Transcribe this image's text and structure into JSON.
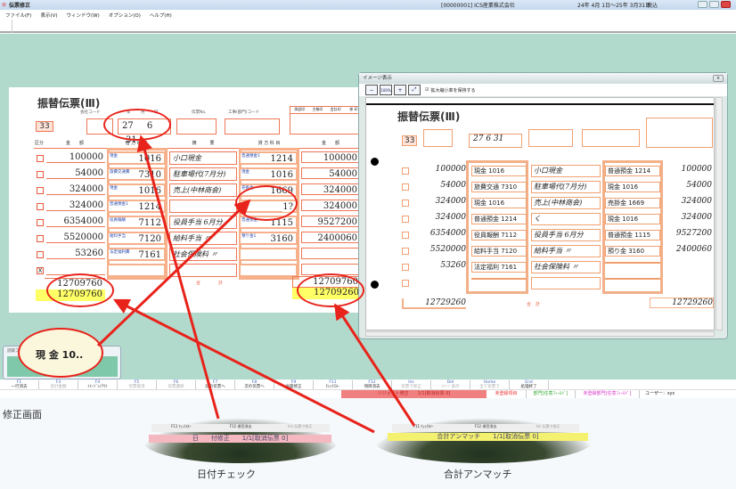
{
  "window": {
    "title": "伝票修正",
    "company": "[00000001] ICS産業株式会社",
    "period": "24年 4月 1日～25年 3月31日",
    "tax_mode": "税込"
  },
  "menu": [
    "ファイル(F)",
    "表示(V)",
    "ウィンドウ(W)",
    "オプション(O)",
    "ヘルプ(H)"
  ],
  "slip": {
    "title": "振替伝票(Ⅲ)",
    "labels": {
      "company_code": "会社コード",
      "year": "年",
      "month": "月",
      "day": "日",
      "slip_no": "伝票No.",
      "dept_code": "工事(部門)コード",
      "approve": [
        "承認印",
        "主帳印",
        "会計印",
        "係 印"
      ],
      "kubun": "区分",
      "amount": "金　　額",
      "debit": "借 方 科 目",
      "code": "(コード)",
      "summary": "摘　　　要",
      "credit": "貸 方 科 目",
      "total": "合　　　　計"
    },
    "company_code": "33",
    "date": {
      "year": "27",
      "month": "6",
      "day": "31"
    },
    "rows": [
      {
        "debit_amount": "100000",
        "debit_name": "現金",
        "debit_code": "1016",
        "summary": "小口現金",
        "credit_name": "普通預金1",
        "credit_code": "1214",
        "credit_amount": "100000"
      },
      {
        "debit_amount": "54000",
        "debit_name": "旅費交通費",
        "debit_code": "7310",
        "summary": "駐車場代(7月分)",
        "credit_name": "現金",
        "credit_code": "1016",
        "credit_amount": "54000"
      },
      {
        "debit_amount": "324000",
        "debit_name": "現金",
        "debit_code": "1016",
        "summary": "売上(中林商会)",
        "credit_name": "売掛金",
        "credit_code": "1669",
        "credit_amount": "324000"
      },
      {
        "debit_amount": "324000",
        "debit_name": "普通預金1",
        "debit_code": "1214",
        "summary": "",
        "credit_name": "",
        "credit_code": "1?",
        "credit_amount": "324000"
      },
      {
        "debit_amount": "6354000",
        "debit_name": "役員報酬",
        "debit_code": "7112",
        "summary": "役員手当 6月分",
        "credit_name": "普通預金",
        "credit_code": "1115",
        "credit_amount": "9527200"
      },
      {
        "debit_amount": "5520000",
        "debit_name": "給料手当",
        "debit_code": "7120",
        "summary": "給料手当 〃",
        "credit_name": "預り金1",
        "credit_code": "3160",
        "credit_amount": "2400060"
      },
      {
        "debit_amount": "53260",
        "debit_name": "法定福利費",
        "debit_code": "7161",
        "summary": "社会保険料 〃",
        "credit_name": "",
        "credit_code": "",
        "credit_amount": ""
      }
    ],
    "last_kubun": "X",
    "debit_total": "12709760",
    "debit_total_calc": "12709760",
    "credit_total": "12709760",
    "credit_total_calc": "12709260"
  },
  "image_window": {
    "title": "イメージ表示",
    "zoom_label": "100%",
    "keep_zoom_label": "拡大縮小率を保持する",
    "keep_zoom_checked": true,
    "slip_title": "振替伝票(Ⅲ)",
    "company_code": "33",
    "date_text": "27 6 31",
    "rows": [
      {
        "debit_amount": "100000",
        "debit": "現金 1016",
        "summary": "小口現金",
        "credit": "普通預金 1214",
        "credit_amount": "100000"
      },
      {
        "debit_amount": "54000",
        "debit": "旅費交通 7310",
        "summary": "駐車場代(7月分)",
        "credit": "現金 1016",
        "credit_amount": "54000"
      },
      {
        "debit_amount": "324000",
        "debit": "現金 1016",
        "summary": "売上(中林商会)",
        "credit": "売掛金 1669",
        "credit_amount": "324000"
      },
      {
        "debit_amount": "324000",
        "debit": "普通預金 1214",
        "summary": "く",
        "credit": "現金 1016",
        "credit_amount": "324000"
      },
      {
        "debit_amount": "6354000",
        "debit": "役員報酬 7112",
        "summary": "役員手当 6月分",
        "credit": "普通預金 1115",
        "credit_amount": "9527200"
      },
      {
        "debit_amount": "5520000",
        "debit": "給料手当 7120",
        "summary": "給料手当 〃",
        "credit": "預り金 3160",
        "credit_amount": "2400060"
      },
      {
        "debit_amount": "53260",
        "debit": "法定福利 7161",
        "summary": "社会保険料 〃",
        "credit": "",
        "credit_amount": ""
      }
    ],
    "debit_total": "12729260",
    "credit_total": "12729260",
    "total_label": "合　計"
  },
  "field_image": {
    "title": "読取フィールドイメージ",
    "content": "現 金  10.."
  },
  "fkeys": [
    {
      "key": "F1",
      "label": "一行消去",
      "enabled": true
    },
    {
      "key": "F3",
      "label": "合計金額",
      "enabled": false
    },
    {
      "key": "F4",
      "label": "ｲﾒｰｼﾞﾚｲｱｳﾄ",
      "enabled": true
    },
    {
      "key": "F5",
      "label": "伝票取消",
      "enabled": false
    },
    {
      "key": "F6",
      "label": "伝票選択",
      "enabled": false
    },
    {
      "key": "F7",
      "label": "前の伝票へ",
      "enabled": true
    },
    {
      "key": "F8",
      "label": "次の伝票へ",
      "enabled": true
    },
    {
      "key": "F9",
      "label": "画面修正",
      "enabled": true
    },
    {
      "key": "F11",
      "label": "ﾁｪｯｸｽﾙｰ",
      "enabled": true
    },
    {
      "key": "F12",
      "label": "項目消去",
      "enabled": true
    },
    {
      "key": "Ins",
      "label": "伝票で修正",
      "enabled": false
    },
    {
      "key": "Del",
      "label": "ｲﾒｰｼﾞ表示",
      "enabled": false
    },
    {
      "key": "Home",
      "label": "全て伝票で",
      "enabled": false
    },
    {
      "key": "End",
      "label": "処理終了",
      "enabled": true
    }
  ],
  "status": {
    "message": "リジェクト修正　　1/1[取消伝票 0]",
    "legend": [
      "未登録項目",
      "部門[任意ﾌｨｰﾙﾄﾞ]",
      "未登録部門[任意ﾌｨｰﾙﾄﾞ]"
    ],
    "user": "ユーザー：sys"
  },
  "annotations": {
    "screen_label": "修正画面",
    "date_check": {
      "caption": "日付チェック",
      "message": "日　　付修正　　1/1[取消伝票 0]",
      "keys": [
        "F11 ﾁｪｯｸｽﾙｰ",
        "F12 項目消去",
        "Ins 伝票で修正"
      ]
    },
    "total_mismatch": {
      "caption": "合計アンマッチ",
      "message": "合計アンマッチ　　1/1[取消伝票 0]",
      "keys": [
        "F11 ﾁｪｯｸｽﾙｰ",
        "F12 項目消去",
        "Ins 伝票で修正"
      ]
    },
    "accent_color": "#e8231b",
    "error_color": "#f08080",
    "warn_color": "#ffff80"
  }
}
